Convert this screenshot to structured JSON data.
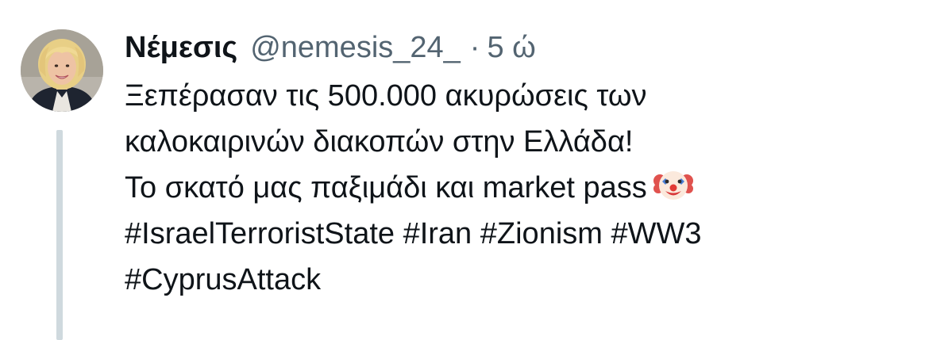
{
  "tweet": {
    "display_name": "Νέμεσις",
    "handle": "@nemesis_24_",
    "separator": "·",
    "timestamp": "5 ώ",
    "text_lines": [
      "Ξεπέρασαν τις 500.000 ακυρώσεις των",
      "καλοκαιρινών διακοπών στην Ελλάδα!",
      "Το σκατό μας παξιμάδι και market pass"
    ],
    "emoji": "clown-face-icon",
    "hashtags_line1": [
      "#IsraelTerroristState",
      "#Iran",
      "#Zionism",
      "#WW3"
    ],
    "hashtags_line2": [
      "#CyprusAttack"
    ]
  },
  "colors": {
    "text": "#0f1419",
    "secondary": "#536471",
    "thread_line": "#cfd9de",
    "background": "#ffffff"
  }
}
